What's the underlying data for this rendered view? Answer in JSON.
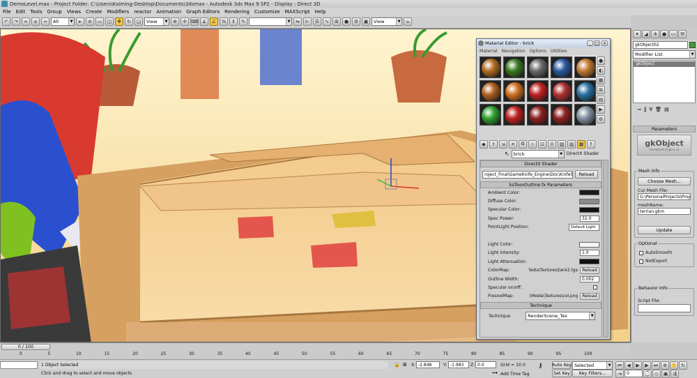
{
  "titlebar": {
    "text": "DemoLevel.max     - Project Folder: C:\\Users\\Kaiming-Desktop\\Documents\\3dsmax     - Autodesk 3ds Max 9 SP2     - Display : Direct 3D"
  },
  "menu": [
    "File",
    "Edit",
    "Tools",
    "Group",
    "Views",
    "Create",
    "Modifiers",
    "reactor",
    "Animation",
    "Graph Editors",
    "Rendering",
    "Customize",
    "MAXScript",
    "Help"
  ],
  "toolbar": {
    "selection_filter": "All",
    "ref_coord": "View",
    "named_sel": "",
    "view_dd": "View"
  },
  "cmd": {
    "object_name": "gkObject02",
    "object_color": "#3aa030",
    "modifier_list": "Modifier List",
    "stack_item": "gkObject",
    "params_title": "Parameters",
    "logo_text": "gkObject",
    "logo_small": "GameKnife Engine v1",
    "mesh_info_title": "Mesh Info",
    "choose_mesh": "Choose Mesh...",
    "cur_mesh_label": "Cur Mesh File:",
    "cur_mesh_value": "G:\\PersonalProjects\\Projec",
    "mesh_name_label": "meshName:",
    "mesh_name_value": "terrian.gkm",
    "update": "Update",
    "optional_title": "Optional",
    "autosmooth": "AutoSmooth",
    "notexport": "NotExport",
    "behavior_title": "Behavior Info",
    "script_label": "Script File:"
  },
  "mated": {
    "title": "Material Editor - brick",
    "menu": [
      "Material",
      "Navigation",
      "Options",
      "Utilities"
    ],
    "material_name": "brick",
    "material_type": "DirectX Shader",
    "spheres": [
      "#b06a20",
      "#3a7a20",
      "#6a6a6a",
      "#2a5aa0",
      "#c07a30",
      "#b06020",
      "#d07020",
      "#c02020",
      "#b03030",
      "#2a70a0",
      "#30a030",
      "#c02020",
      "#8a2020",
      "#902020",
      "#8090a0"
    ],
    "dx_title": "DirectX Shader",
    "dx_path": "roject_Final\\GameKnife_Engine\\Doc\\KnifeShad",
    "reload": "Reload",
    "fx_title": "ksToonOutline.fx Parameters",
    "params": [
      {
        "label": "Ambient Color:",
        "kind": "swatch",
        "color": "#1a1a1a"
      },
      {
        "label": "Diffuse Color:",
        "kind": "swatch",
        "color": "#8a8a8a"
      },
      {
        "label": "Specular Color:",
        "kind": "swatch",
        "color": "#111111"
      },
      {
        "label": "Spec Power:",
        "kind": "num",
        "value": "32.0"
      },
      {
        "label": "PointLight Position:",
        "kind": "dd",
        "value": "Default Light"
      },
      {
        "label": "",
        "kind": "blank"
      },
      {
        "label": "Light Color:",
        "kind": "swatch",
        "color": "#f4f4f4"
      },
      {
        "label": "Light Intensity:",
        "kind": "num",
        "value": "1.0"
      },
      {
        "label": "Light Attenuation:",
        "kind": "swatch",
        "color": "#111111"
      },
      {
        "label": "ColorMap:",
        "kind": "file",
        "value": "fedia\\Textures\\tank2.tga"
      },
      {
        "label": "Outline Width:",
        "kind": "num",
        "value": "0.002"
      },
      {
        "label": "Specular on/off:",
        "kind": "check",
        "value": ""
      },
      {
        "label": "FresnelMap:",
        "kind": "file",
        "value": ":\\Media\\Textures\\cel.png"
      }
    ],
    "technique_title": "Technique",
    "technique_label": "Technique",
    "technique_value": "RenderScene_Tex"
  },
  "timeline": {
    "slider": "0 / 100",
    "ticks": [
      "0",
      "5",
      "10",
      "15",
      "20",
      "25",
      "30",
      "35",
      "40",
      "45",
      "50",
      "55",
      "60",
      "65",
      "70",
      "75",
      "80",
      "85",
      "90",
      "95",
      "100"
    ]
  },
  "status": {
    "selected": "1 Object Selected",
    "prompt": "Click and drag to select and move objects",
    "x_label": "X:",
    "x": "-2.848",
    "y_label": "Y:",
    "y": "-1.983",
    "z_label": "Z:",
    "z": "0.0",
    "grid": "Grid = 10.0",
    "add_time_tag": "Add Time Tag",
    "auto_key": "Auto Key",
    "selected_dd": "Selected",
    "set_key": "Set Key",
    "key_filters": "Key Filters...",
    "frame": "0"
  }
}
